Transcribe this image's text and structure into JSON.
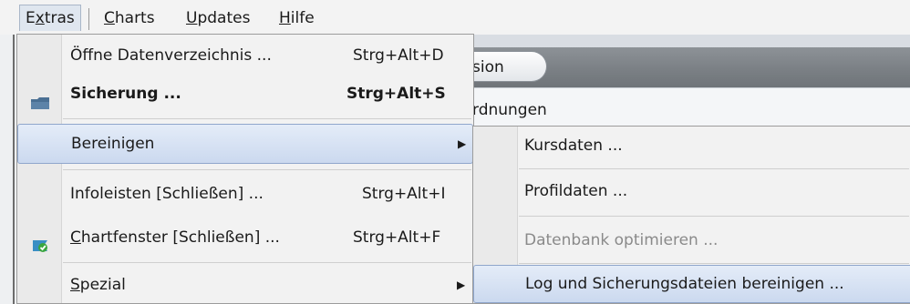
{
  "menubar": {
    "items": [
      {
        "label": "Extras",
        "mnemonic_index": 1
      },
      {
        "label": "Charts",
        "mnemonic_index": 0
      },
      {
        "label": "Updates",
        "mnemonic_index": 0
      },
      {
        "label": "Hilfe",
        "mnemonic_index": 0
      }
    ]
  },
  "background": {
    "tab_label": "sion",
    "panel_header": "rdnungen"
  },
  "extras_menu": {
    "items": [
      {
        "label": "Öffne Datenverzeichnis ...",
        "shortcut": "Strg+Alt+D",
        "bold": false,
        "icon": null
      },
      {
        "label": "Sicherung ...",
        "shortcut": "Strg+Alt+S",
        "bold": true,
        "icon": "backup-icon"
      },
      {
        "label": "Bereinigen",
        "shortcut": "",
        "submenu": true,
        "highlighted": true
      },
      {
        "label": "Infoleisten [Schließen] ...",
        "shortcut": "Strg+Alt+I"
      },
      {
        "label": "Chartfenster [Schließen] ...",
        "shortcut": "Strg+Alt+F",
        "icon": "chart-window-icon"
      },
      {
        "label": "Spezial",
        "shortcut": "",
        "submenu": true
      }
    ]
  },
  "bereinigen_menu": {
    "items": [
      {
        "label": "Kursdaten ...",
        "enabled": true
      },
      {
        "label": "Profildaten ...",
        "enabled": true
      },
      {
        "label": "Datenbank optimieren ...",
        "enabled": false
      },
      {
        "label": "Log und Sicherungsdateien bereinigen ...",
        "enabled": true,
        "highlighted": true
      }
    ]
  },
  "colors": {
    "highlight": "#cbd9ef",
    "highlight_border": "#8fa6cc",
    "menu_bg": "#f2f2f2",
    "toolbar": "#7b8085"
  }
}
